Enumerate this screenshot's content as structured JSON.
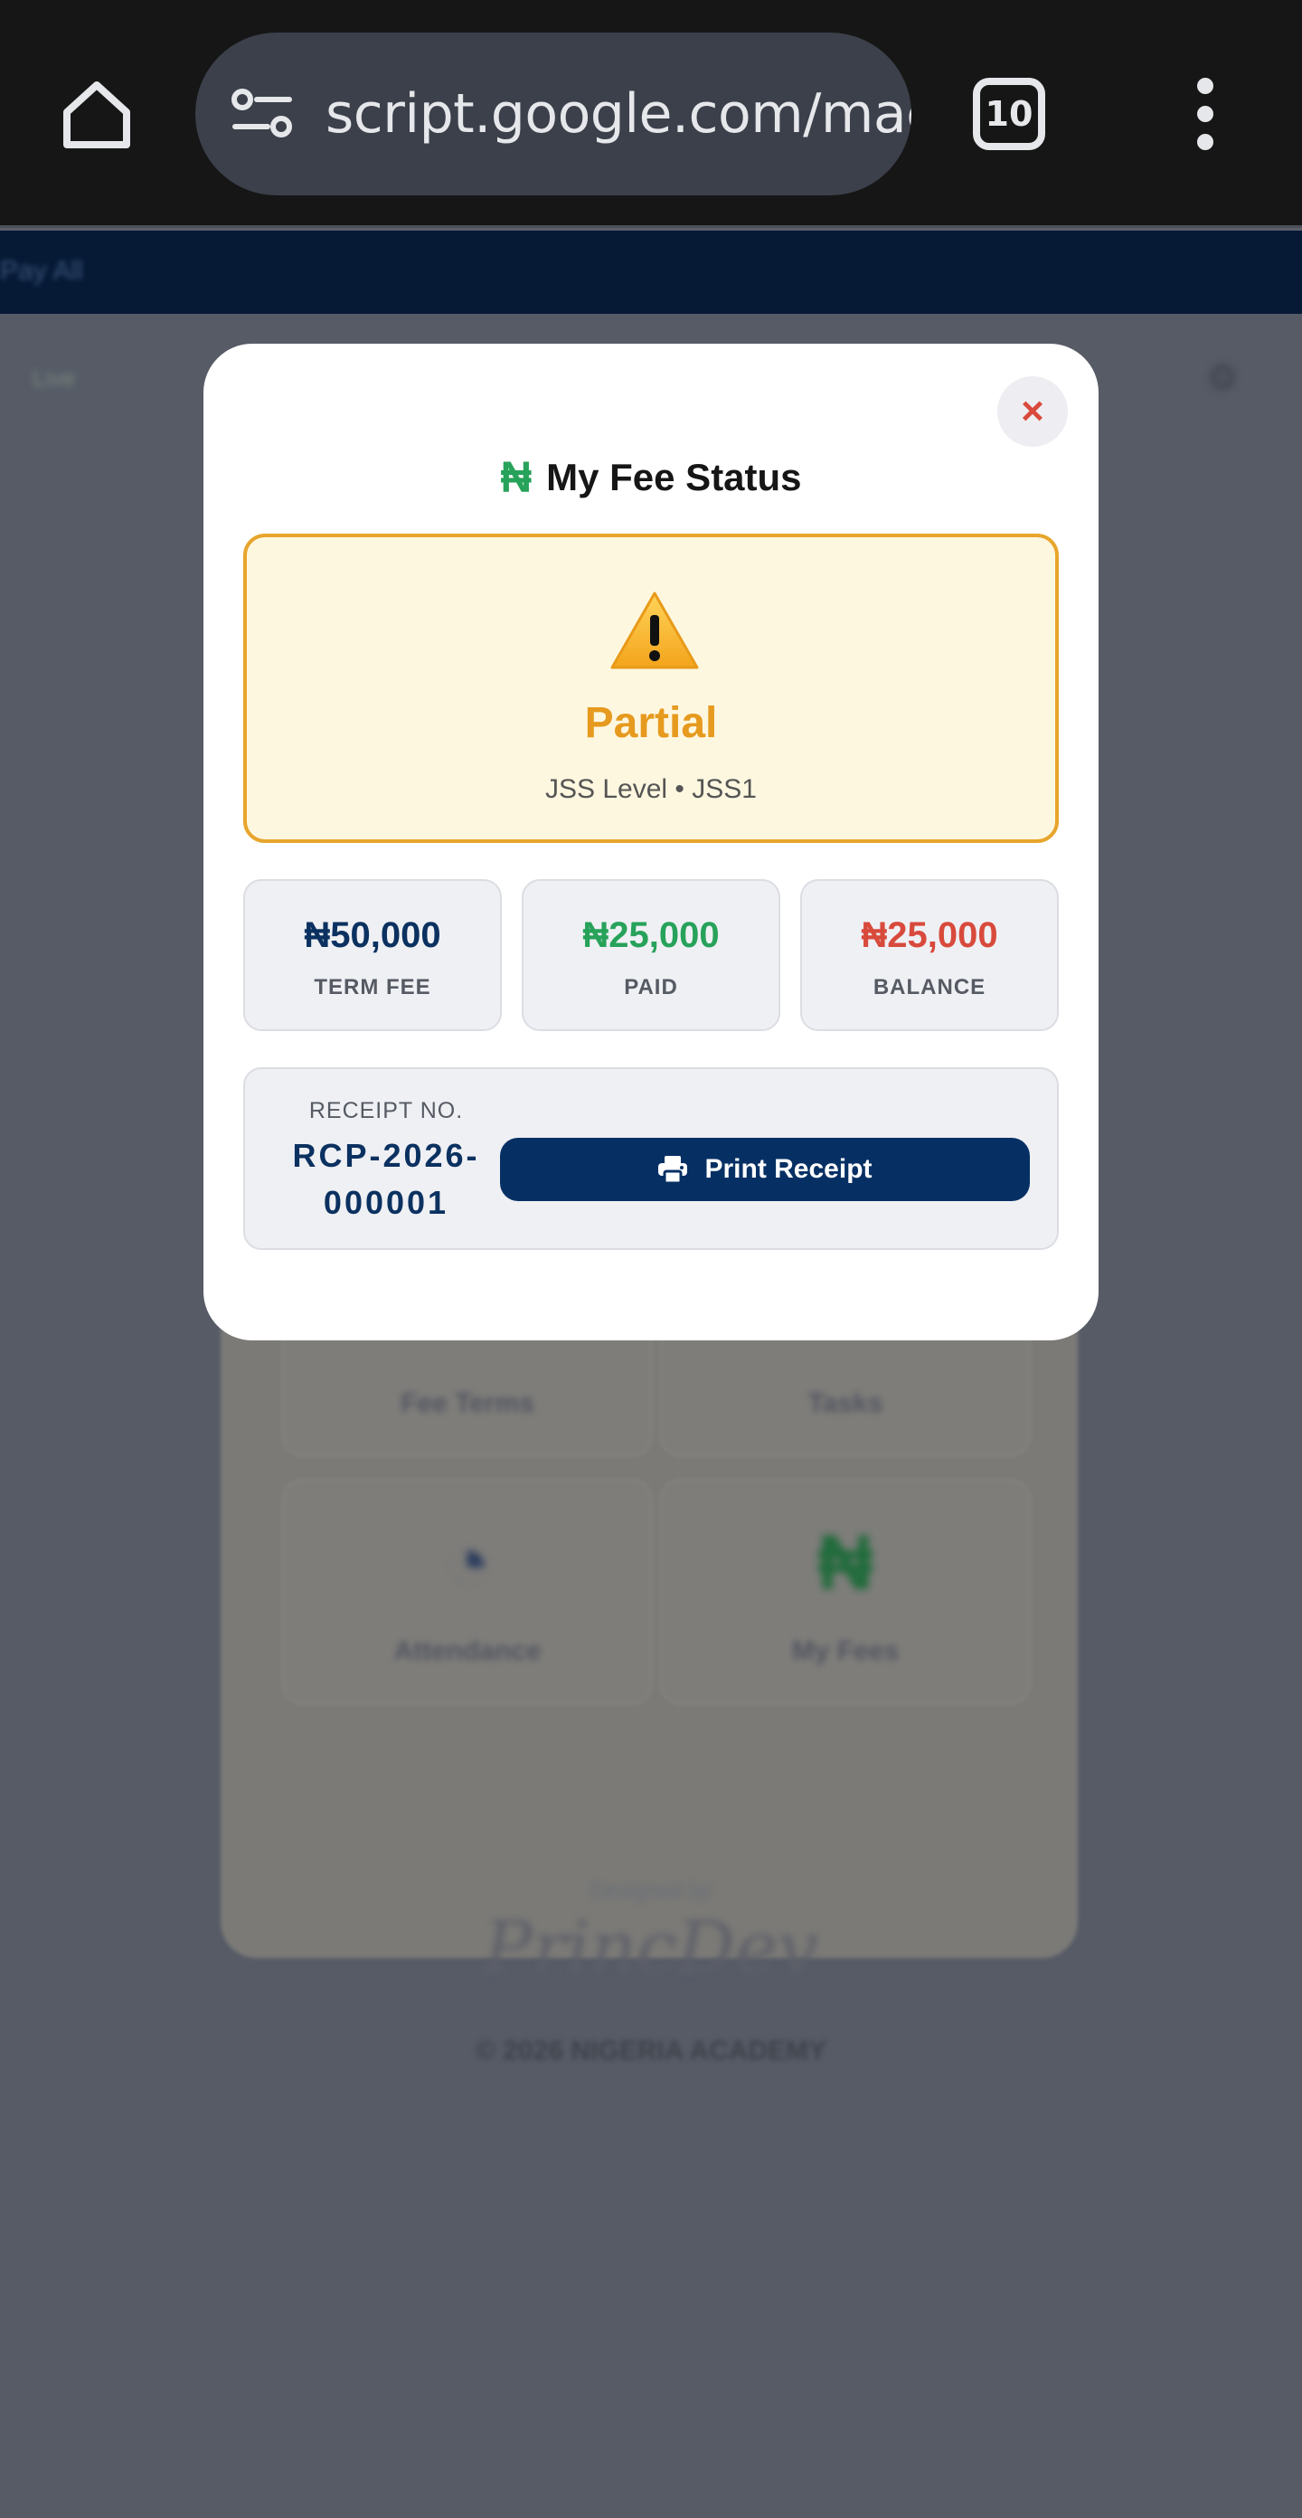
{
  "browser": {
    "url": "script.google.com/macros",
    "tab_count": "10"
  },
  "background": {
    "topbar_text": "Pay All",
    "tag_text": "Live",
    "tiles": [
      {
        "label": "Fee Terms",
        "icon": "document-icon"
      },
      {
        "label": "Tasks",
        "icon": "tasks-icon"
      },
      {
        "label": "Attendance",
        "icon": "pie-chart-icon",
        "icon_glyph": "◔"
      },
      {
        "label": "My Fees",
        "icon": "naira-icon",
        "icon_glyph": "₦"
      }
    ],
    "footer_small": "Designed by",
    "footer_signature": "PrincDev",
    "footer_copyright": "© 2026 NIGERIA ACADEMY"
  },
  "modal": {
    "close_label": "×",
    "title_icon": "₦",
    "title": "My Fee Status",
    "status": {
      "label": "Partial",
      "subtitle": "JSS Level • JSS1",
      "colors": {
        "accent": "#e69a1e",
        "background": "#fef7e0",
        "border": "#e8a52c"
      }
    },
    "stats": [
      {
        "value": "₦50,000",
        "label": "TERM FEE",
        "color": "#0b3160"
      },
      {
        "value": "₦25,000",
        "label": "PAID",
        "color": "#27a25a"
      },
      {
        "value": "₦25,000",
        "label": "BALANCE",
        "color": "#d84a3c"
      }
    ],
    "receipt": {
      "label": "RECEIPT NO.",
      "number": "RCP-2026-000001",
      "print_label": "Print Receipt"
    }
  }
}
